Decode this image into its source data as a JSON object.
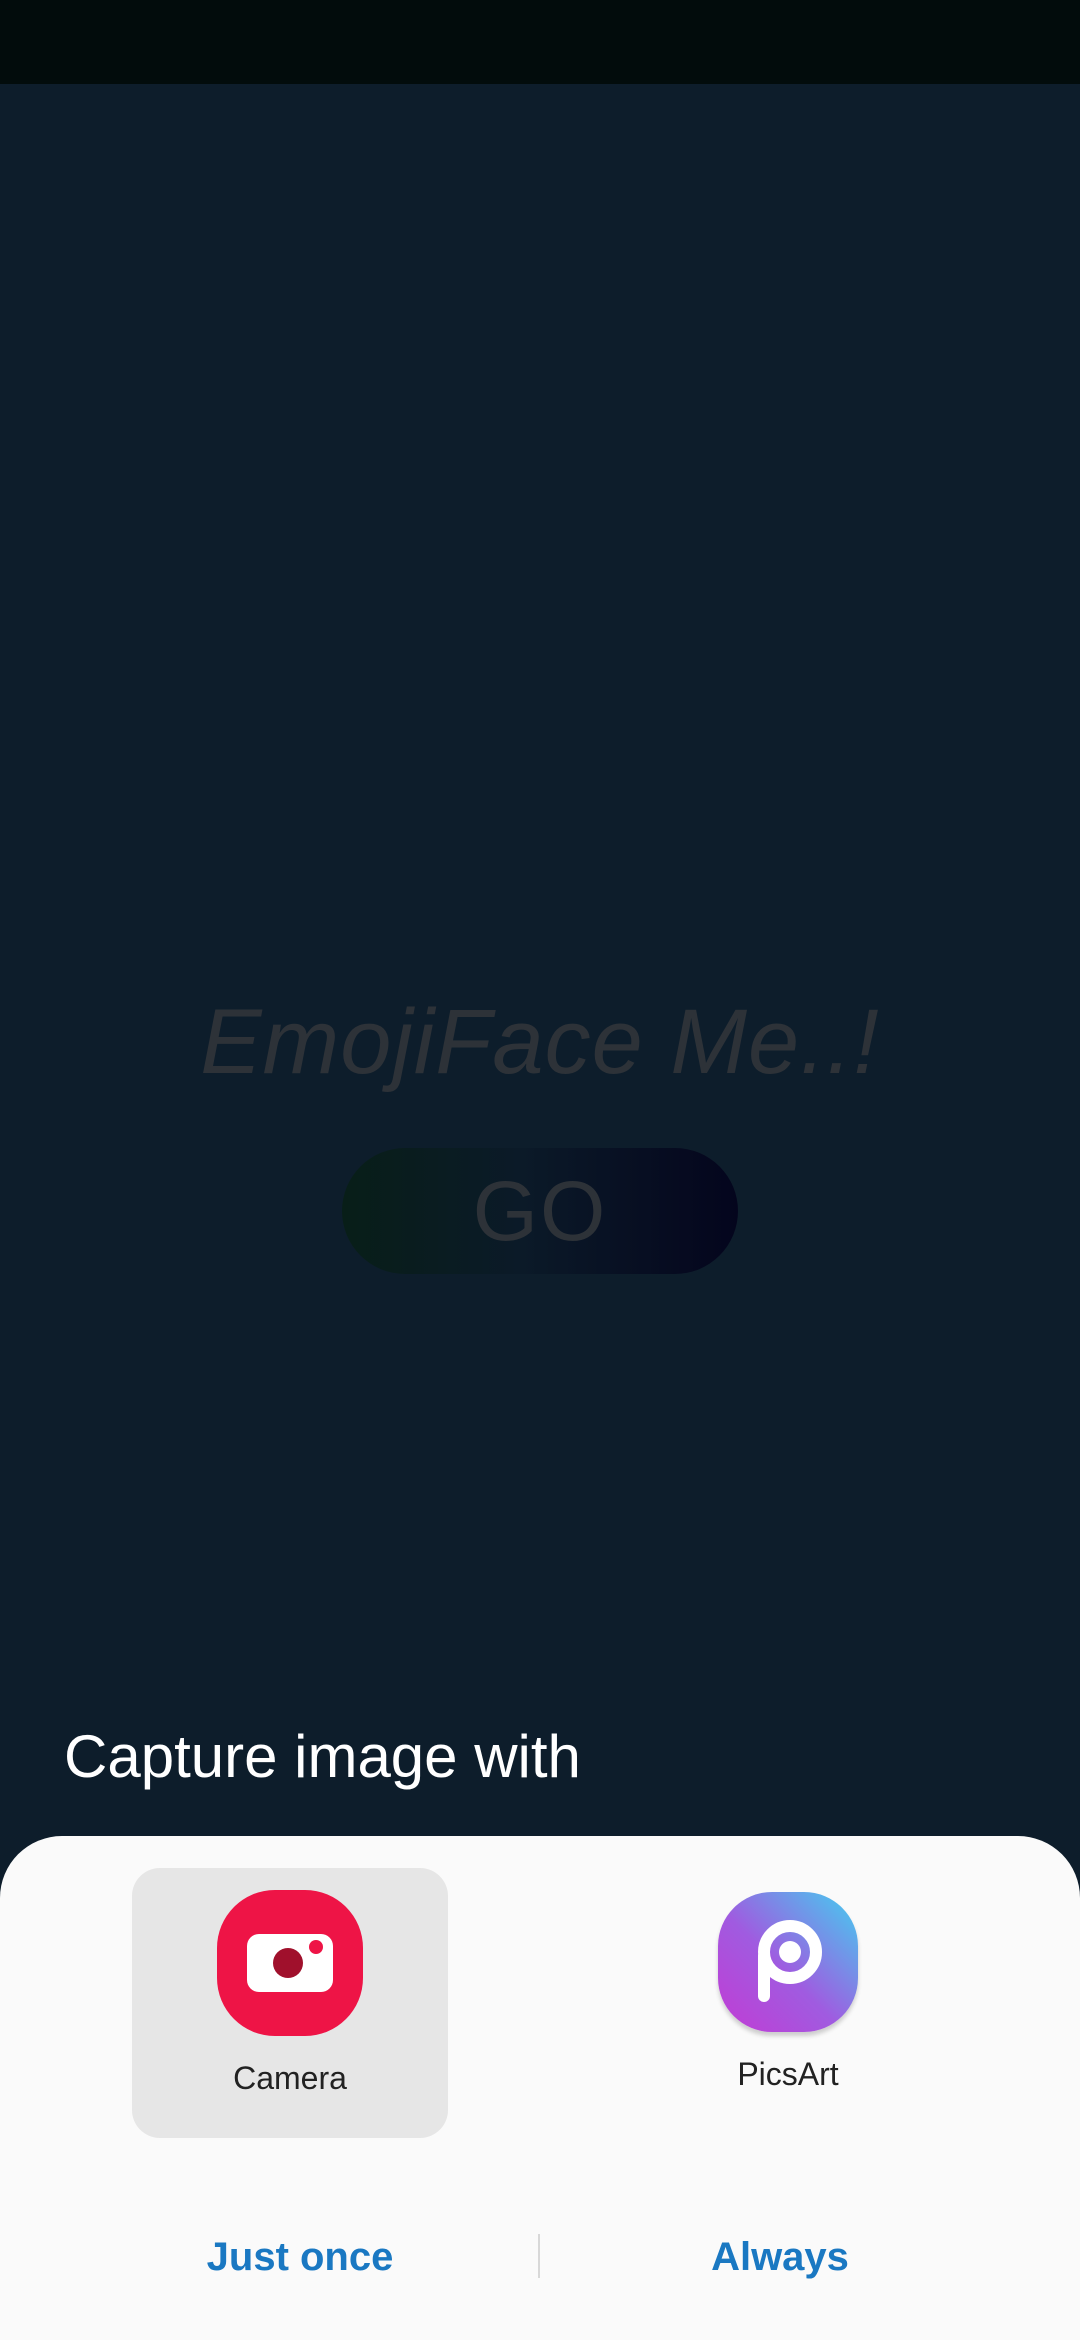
{
  "app": {
    "title": "EmojiFace Me..!",
    "go_label": "GO"
  },
  "dialog": {
    "title": "Capture image with",
    "options": [
      {
        "label": "Camera",
        "icon": "camera-icon",
        "selected": true
      },
      {
        "label": "PicsArt",
        "icon": "picsart-icon",
        "selected": false
      }
    ],
    "actions": {
      "just_once": "Just once",
      "always": "Always"
    }
  },
  "colors": {
    "background": "#0d1d2b",
    "accent": "#1a78c2",
    "camera": "#ee1446"
  }
}
